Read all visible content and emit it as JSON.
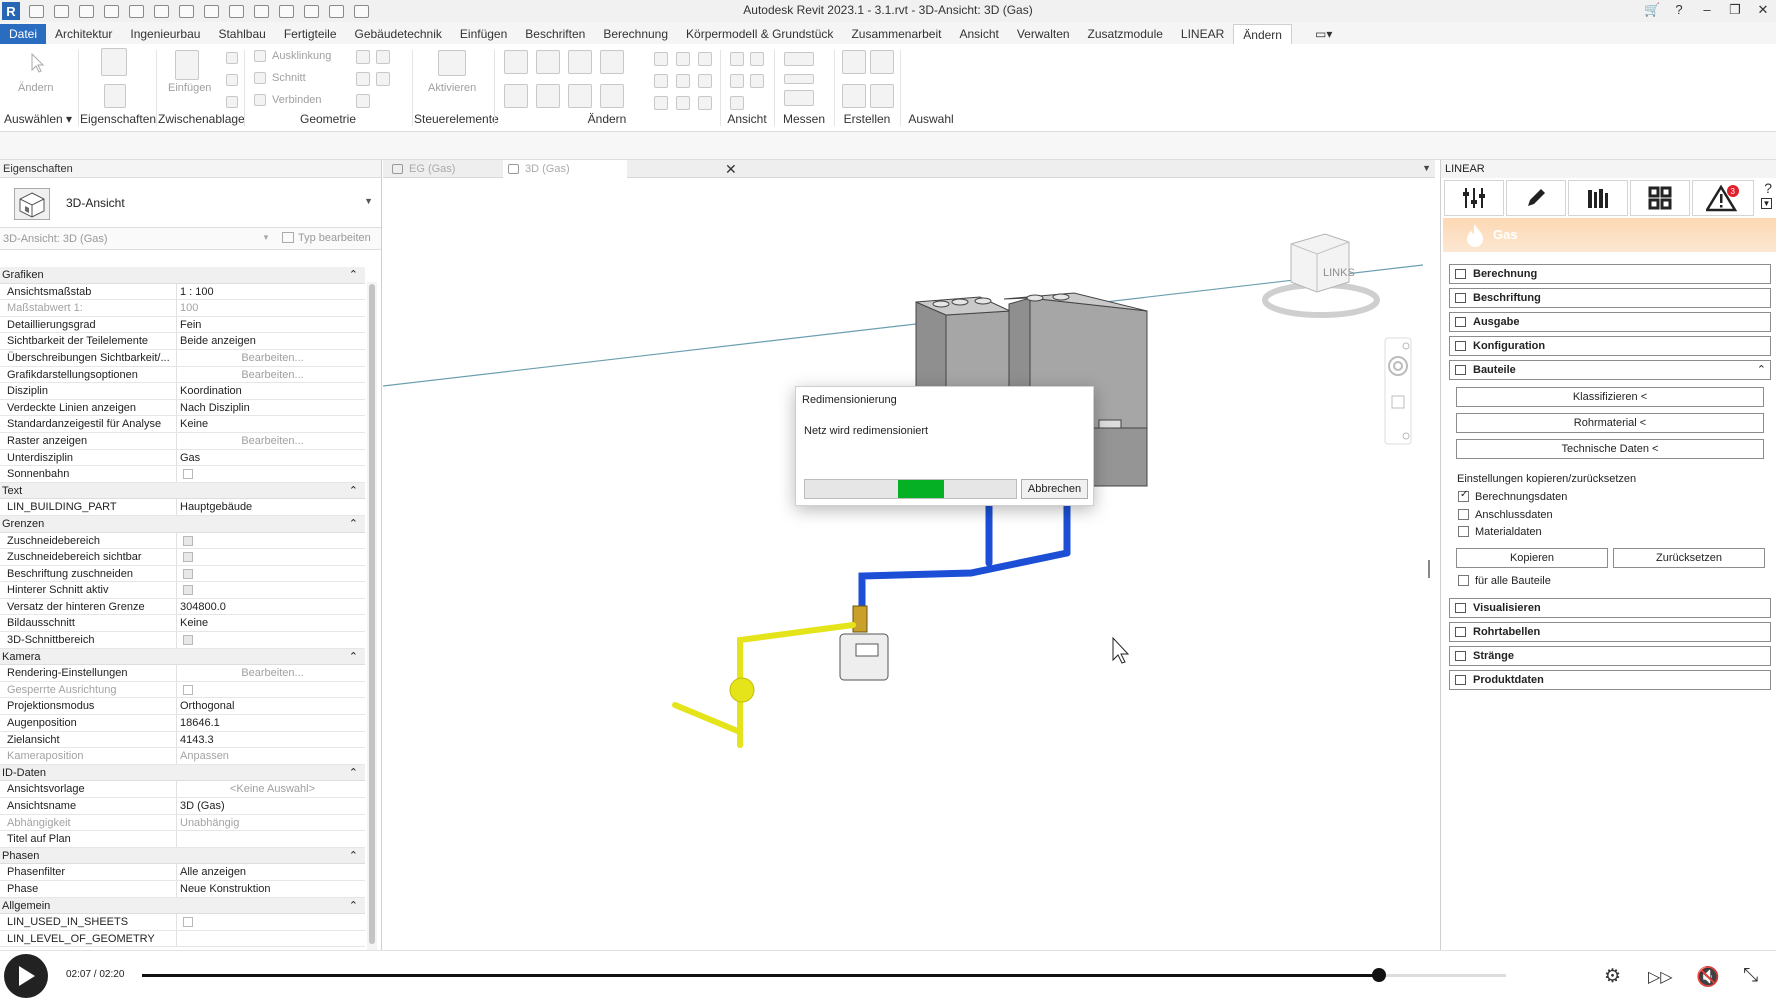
{
  "window": {
    "title": "Autodesk Revit 2023.1 - 3.1.rvt - 3D-Ansicht: 3D (Gas)"
  },
  "menu": [
    "Datei",
    "Architektur",
    "Ingenieurbau",
    "Stahlbau",
    "Fertigteile",
    "Gebäudetechnik",
    "Einfügen",
    "Beschriften",
    "Berechnung",
    "Körpermodell & Grundstück",
    "Zusammenarbeit",
    "Ansicht",
    "Verwalten",
    "Zusatzmodule",
    "LINEAR",
    "Ändern"
  ],
  "ribbon": {
    "groups": [
      "Auswählen ▾",
      "Eigenschaften",
      "Zwischenablage",
      "Geometrie",
      "Steuerelemente",
      "Ändern",
      "Ansicht",
      "Messen",
      "Erstellen",
      "Auswahl"
    ],
    "tools": {
      "modify": "Ändern",
      "paste": "Einfügen",
      "cope": "Ausklinkung",
      "cut": "Schnitt",
      "join": "Verbinden",
      "activate": "Aktivieren"
    }
  },
  "properties": {
    "header": "Eigenschaften",
    "type_name": "3D-Ansicht",
    "view_selector": "3D-Ansicht: 3D (Gas)",
    "edit_type": "Typ bearbeiten",
    "sections": [
      {
        "title": "Grafiken",
        "rows": [
          {
            "k": "Ansichtsmaßstab",
            "v": "1 : 100"
          },
          {
            "k": "Maßstabwert  1:",
            "v": "100",
            "dis": true
          },
          {
            "k": "Detaillierungsgrad",
            "v": "Fein"
          },
          {
            "k": "Sichtbarkeit der Teilelemente",
            "v": "Beide anzeigen"
          },
          {
            "k": "Überschreibungen Sichtbarkeit/...",
            "v": "Bearbeiten...",
            "edit": true
          },
          {
            "k": "Grafikdarstellungsoptionen",
            "v": "Bearbeiten...",
            "edit": true
          },
          {
            "k": "Disziplin",
            "v": "Koordination"
          },
          {
            "k": "Verdeckte Linien anzeigen",
            "v": "Nach Disziplin"
          },
          {
            "k": "Standardanzeigestil für Analyse",
            "v": "Keine"
          },
          {
            "k": "Raster anzeigen",
            "v": "Bearbeiten...",
            "edit": true
          },
          {
            "k": "Unterdisziplin",
            "v": "Gas"
          },
          {
            "k": "Sonnenbahn",
            "cb": "off"
          }
        ]
      },
      {
        "title": "Text",
        "rows": [
          {
            "k": "LIN_BUILDING_PART",
            "v": "Hauptgebäude"
          }
        ]
      },
      {
        "title": "Grenzen",
        "rows": [
          {
            "k": "Zuschneidebereich",
            "cb": "on"
          },
          {
            "k": "Zuschneidebereich sichtbar",
            "cb": "on"
          },
          {
            "k": "Beschriftung zuschneiden",
            "cb": "on"
          },
          {
            "k": "Hinterer Schnitt aktiv",
            "cb": "on"
          },
          {
            "k": "Versatz der hinteren Grenze",
            "v": "304800.0"
          },
          {
            "k": "Bildausschnitt",
            "v": "Keine"
          },
          {
            "k": "3D-Schnittbereich",
            "cb": "on"
          }
        ]
      },
      {
        "title": "Kamera",
        "rows": [
          {
            "k": "Rendering-Einstellungen",
            "v": "Bearbeiten...",
            "edit": true
          },
          {
            "k": "Gesperrte Ausrichtung",
            "cb": "off",
            "dis": true
          },
          {
            "k": "Projektionsmodus",
            "v": "Orthogonal"
          },
          {
            "k": "Augenposition",
            "v": "18646.1"
          },
          {
            "k": "Zielansicht",
            "v": "4143.3"
          },
          {
            "k": "Kameraposition",
            "v": "Anpassen",
            "dis": true
          }
        ]
      },
      {
        "title": "ID-Daten",
        "rows": [
          {
            "k": "Ansichtsvorlage",
            "v": "<Keine Auswahl>",
            "edit": true
          },
          {
            "k": "Ansichtsname",
            "v": "3D (Gas)"
          },
          {
            "k": "Abhängigkeit",
            "v": "Unabhängig",
            "dis": true
          },
          {
            "k": "Titel auf Plan",
            "v": ""
          }
        ]
      },
      {
        "title": "Phasen",
        "rows": [
          {
            "k": "Phasenfilter",
            "v": "Alle anzeigen"
          },
          {
            "k": "Phase",
            "v": "Neue Konstruktion"
          }
        ]
      },
      {
        "title": "Allgemein",
        "rows": [
          {
            "k": "LIN_USED_IN_SHEETS",
            "cb": "off"
          },
          {
            "k": "LIN_LEVEL_OF_GEOMETRY",
            "v": ""
          }
        ]
      }
    ]
  },
  "view_tabs": [
    {
      "label": "EG (Gas)"
    },
    {
      "label": "3D (Gas)",
      "active": true
    }
  ],
  "viewcube_label": "LINKS",
  "dialog": {
    "title": "Redimensionierung",
    "message": "Netz wird redimensioniert",
    "cancel": "Abbrechen",
    "progress_start": 0.44,
    "progress_end": 0.66
  },
  "linear_panel": {
    "header": "LINEAR",
    "network": "Gas",
    "alert_count": "3",
    "sections_top": [
      "Berechnung",
      "Beschriftung",
      "Ausgabe",
      "Konfiguration",
      "Bauteile"
    ],
    "bauteile_buttons": [
      "Klassifizieren  <",
      "Rohrmaterial  <",
      "Technische Daten  <"
    ],
    "settings_label": "Einstellungen kopieren/zurücksetzen",
    "checks": [
      {
        "label": "Berechnungsdaten",
        "checked": true
      },
      {
        "label": "Anschlussdaten",
        "checked": false
      },
      {
        "label": "Materialdaten",
        "checked": false
      }
    ],
    "copy": "Kopieren",
    "reset": "Zurücksetzen",
    "all_parts": "für alle Bauteile",
    "sections_bottom": [
      "Visualisieren",
      "Rohrtabellen",
      "Stränge",
      "Produktdaten"
    ]
  },
  "video": {
    "time": "02:07 / 02:20",
    "progress": 0.907
  }
}
